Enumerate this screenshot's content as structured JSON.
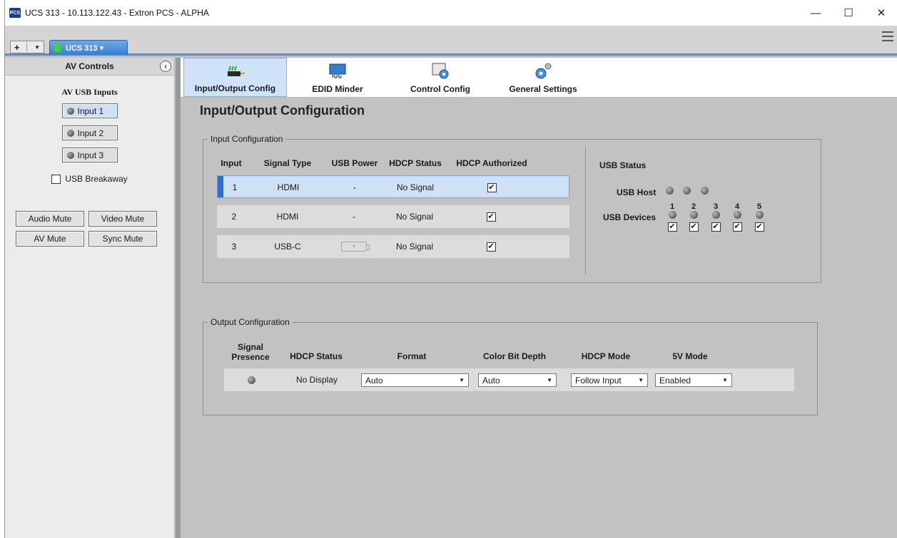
{
  "window": {
    "title": "UCS 313 - 10.113.122.43 - Extron PCS - ALPHA",
    "app_icon_text": "PCS",
    "minimize": "—",
    "maximize": "☐",
    "close": "✕"
  },
  "tabbar": {
    "add": "+",
    "device_tab": "UCS 313 ▾"
  },
  "left_panel": {
    "header": "AV Controls",
    "section_title": "AV USB Inputs",
    "inputs": [
      "Input 1",
      "Input 2",
      "Input 3"
    ],
    "selected_input": 0,
    "usb_breakaway": "USB Breakaway",
    "usb_breakaway_checked": false,
    "mute_buttons": [
      "Audio Mute",
      "Video Mute",
      "AV Mute",
      "Sync Mute"
    ]
  },
  "toolbar": {
    "items": [
      "Input/Output Config",
      "EDID Minder",
      "Control Config",
      "General Settings"
    ],
    "active": 0
  },
  "page_title": "Input/Output Configuration",
  "input_config": {
    "legend": "Input Configuration",
    "headers": {
      "input": "Input",
      "signal_type": "Signal Type",
      "usb_power": "USB Power",
      "hdcp_status": "HDCP Status",
      "hdcp_authorized": "HDCP Authorized"
    },
    "rows": [
      {
        "input": "1",
        "signal_type": "HDMI",
        "usb_power": "-",
        "hdcp_status": "No Signal",
        "authorized": true
      },
      {
        "input": "2",
        "signal_type": "HDMI",
        "usb_power": "-",
        "hdcp_status": "No Signal",
        "authorized": true
      },
      {
        "input": "3",
        "signal_type": "USB-C",
        "usb_power": "battery-icon",
        "hdcp_status": "No Signal",
        "authorized": true
      }
    ]
  },
  "usb_status": {
    "title": "USB Status",
    "host_label": "USB Host",
    "host_leds": 3,
    "devices_label": "USB Devices",
    "device_numbers": [
      "1",
      "2",
      "3",
      "4",
      "5"
    ],
    "device_checked": [
      true,
      true,
      true,
      true,
      true
    ]
  },
  "output_config": {
    "legend": "Output Configuration",
    "headers": {
      "signal_presence": "Signal Presence",
      "hdcp_status": "HDCP Status",
      "format": "Format",
      "color_bit_depth": "Color Bit Depth",
      "hdcp_mode": "HDCP Mode",
      "five_v_mode": "5V Mode"
    },
    "row": {
      "hdcp_status": "No Display",
      "format": "Auto",
      "color_bit_depth": "Auto",
      "hdcp_mode": "Follow Input",
      "five_v_mode": "Enabled"
    }
  },
  "colors": {
    "accent": "#5b8cc7",
    "selected_row": "#cfe1f5",
    "row_marker": "#2f6ed0",
    "panel_bg": "#c2c2c2"
  }
}
